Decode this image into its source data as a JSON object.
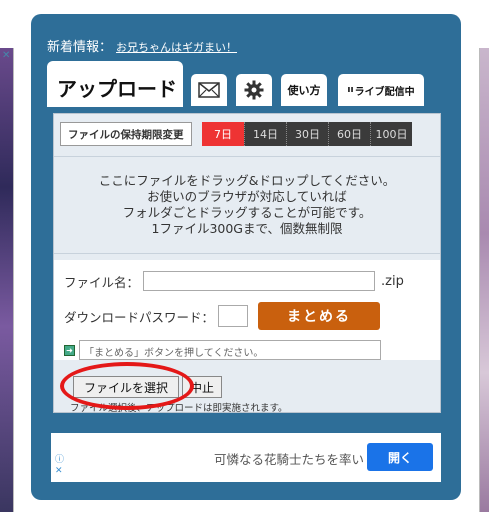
{
  "news": {
    "label": "新着情報：",
    "link": "お兄ちゃんはギガまい！"
  },
  "tabs": {
    "upload": "アップロード",
    "howto": "使い方",
    "live": "ライブ配信中"
  },
  "retention": {
    "label": "ファイルの保持期限変更",
    "days": [
      "7日",
      "14日",
      "30日",
      "60日",
      "100日"
    ],
    "selected": "7日"
  },
  "dropzone": {
    "lines": [
      "ここにファイルをドラッグ&ドロップしてください。",
      "お使いのブラウザが対応していれば",
      "フォルダごとドラッグすることが可能です。",
      "1ファイル300Gまで、個数無制限"
    ]
  },
  "form": {
    "filename_label": "ファイル名：",
    "filename_value": "",
    "ext": ".zip",
    "password_label": "ダウンロードパスワード：",
    "password_value": "",
    "matomeru": "まとめる",
    "status": "「まとめる」ボタンを押してください。"
  },
  "actions": {
    "select_file": "ファイルを選択",
    "stop": "中止",
    "note": "ファイル選択後、アップロードは即実施されます。"
  },
  "ad": {
    "text": "可憐なる花騎士たちを率い",
    "open": "開く"
  },
  "colors": {
    "panel": "#2e6e98",
    "accent_red": "#e33333",
    "matomeru": "#c9600e",
    "ad_button": "#1a73e8",
    "highlight_circle": "#e41818"
  }
}
